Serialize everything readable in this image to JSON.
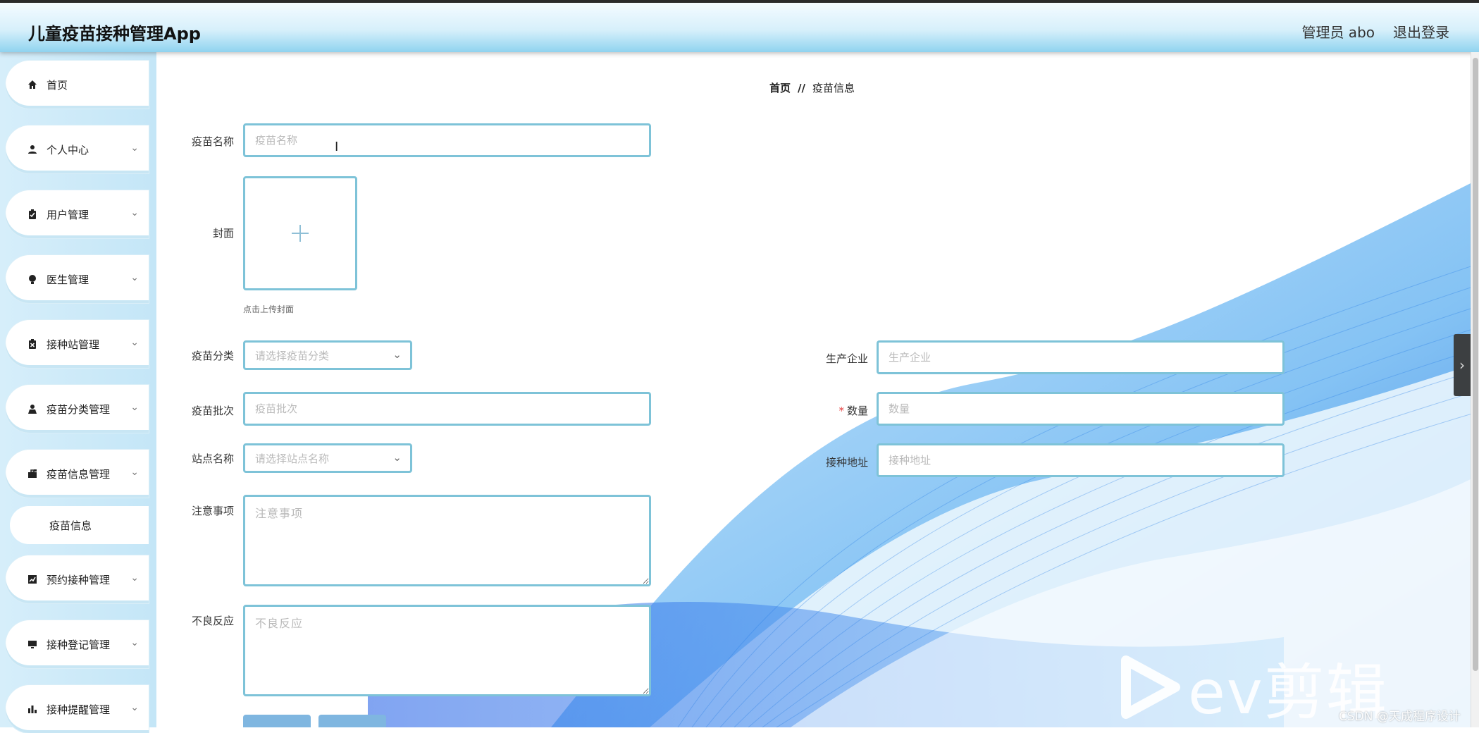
{
  "header": {
    "app_title": "儿童疫苗接种管理App",
    "user_label": "管理员 abo",
    "logout_label": "退出登录"
  },
  "sidebar": {
    "items": [
      {
        "label": "首页",
        "icon": "home-icon",
        "has_children": false
      },
      {
        "label": "个人中心",
        "icon": "user-icon",
        "has_children": true
      },
      {
        "label": "用户管理",
        "icon": "clipboard-icon",
        "has_children": true
      },
      {
        "label": "医生管理",
        "icon": "bulb-icon",
        "has_children": true
      },
      {
        "label": "接种站管理",
        "icon": "clipboard-x-icon",
        "has_children": true
      },
      {
        "label": "疫苗分类管理",
        "icon": "person-icon",
        "has_children": true
      },
      {
        "label": "疫苗信息管理",
        "icon": "briefcase-icon",
        "has_children": true
      },
      {
        "label": "预约接种管理",
        "icon": "chart-icon",
        "has_children": true
      },
      {
        "label": "接种登记管理",
        "icon": "monitor-icon",
        "has_children": true
      },
      {
        "label": "接种提醒管理",
        "icon": "bar-chart-icon",
        "has_children": true
      }
    ],
    "active_sub": "疫苗信息"
  },
  "breadcrumb": {
    "home": "首页",
    "separator": "//",
    "current": "疫苗信息"
  },
  "form": {
    "vaccine_name": {
      "label": "疫苗名称",
      "placeholder": "疫苗名称"
    },
    "cover": {
      "label": "封面",
      "hint": "点击上传封面"
    },
    "vaccine_category": {
      "label": "疫苗分类",
      "placeholder": "请选择疫苗分类"
    },
    "manufacturer": {
      "label": "生产企业",
      "placeholder": "生产企业"
    },
    "vaccine_batch": {
      "label": "疫苗批次",
      "placeholder": "疫苗批次"
    },
    "quantity": {
      "label": "数量",
      "placeholder": "数量",
      "required_mark": "*"
    },
    "station_name": {
      "label": "站点名称",
      "placeholder": "请选择站点名称"
    },
    "vaccination_address": {
      "label": "接种地址",
      "placeholder": "接种地址"
    },
    "notes": {
      "label": "注意事项",
      "placeholder": "注意事项"
    },
    "adverse_reactions": {
      "label": "不良反应",
      "placeholder": "不良反应"
    }
  },
  "watermark": {
    "brand": "ev剪辑",
    "credit": "CSDN @天成程序设计"
  },
  "colors": {
    "accent_border": "#7ec3d8",
    "header_gradient_end": "#8fd3ef",
    "sidebar_bg": "#c4e6f7",
    "button_bg": "#7fb6e0"
  }
}
